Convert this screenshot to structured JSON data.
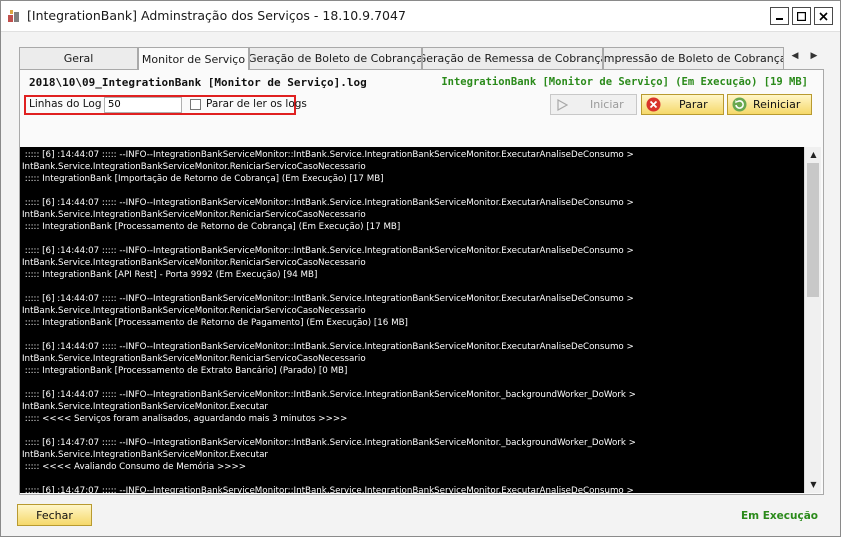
{
  "window": {
    "title": "[IntegrationBank] Adminstração dos Serviços - 18.10.9.7047",
    "controls": [
      "minimize-icon",
      "maximize-icon",
      "close-icon"
    ]
  },
  "tabs": [
    {
      "label": "Geral",
      "active": false
    },
    {
      "label": "Monitor de Serviço",
      "active": true
    },
    {
      "label": "Geração de Boleto de Cobrança",
      "active": false
    },
    {
      "label": "Geração de Remessa de Cobrança",
      "active": false
    },
    {
      "label": "Impressão de Boleto de Cobrança",
      "active": false
    }
  ],
  "monitor": {
    "log_file": "2018\\10\\09_IntegrationBank [Monitor de Serviço].log",
    "service_status": "IntegrationBank [Monitor de Serviço] (Em Execução) [19 MB]",
    "lines_label": "Linhas do Log",
    "lines_value": "50",
    "stop_reading_label": "Parar de ler os logs",
    "stop_reading_checked": false,
    "buttons": {
      "start": "Iniciar",
      "stop": "Parar",
      "restart": "Reiniciar"
    },
    "log_entries": [
      [
        " ::::: [6] :14:44:07 ::::: --INFO--IntegrationBankServiceMonitor::IntBank.Service.IntegrationBankServiceMonitor.ExecutarAnaliseDeConsumo >",
        "IntBank.Service.IntegrationBankServiceMonitor.ReniciarServicoCasoNecessario",
        " ::::: IntegrationBank [Importação de Retorno de Cobrança] (Em Execução) [17 MB]"
      ],
      [
        " ::::: [6] :14:44:07 ::::: --INFO--IntegrationBankServiceMonitor::IntBank.Service.IntegrationBankServiceMonitor.ExecutarAnaliseDeConsumo >",
        "IntBank.Service.IntegrationBankServiceMonitor.ReniciarServicoCasoNecessario",
        " ::::: IntegrationBank [Processamento de Retorno de Cobrança] (Em Execução) [17 MB]"
      ],
      [
        " ::::: [6] :14:44:07 ::::: --INFO--IntegrationBankServiceMonitor::IntBank.Service.IntegrationBankServiceMonitor.ExecutarAnaliseDeConsumo >",
        "IntBank.Service.IntegrationBankServiceMonitor.ReniciarServicoCasoNecessario",
        " ::::: IntegrationBank [API Rest] - Porta 9992 (Em Execução) [94 MB]"
      ],
      [
        " ::::: [6] :14:44:07 ::::: --INFO--IntegrationBankServiceMonitor::IntBank.Service.IntegrationBankServiceMonitor.ExecutarAnaliseDeConsumo >",
        "IntBank.Service.IntegrationBankServiceMonitor.ReniciarServicoCasoNecessario",
        " ::::: IntegrationBank [Processamento de Retorno de Pagamento] (Em Execução) [16 MB]"
      ],
      [
        " ::::: [6] :14:44:07 ::::: --INFO--IntegrationBankServiceMonitor::IntBank.Service.IntegrationBankServiceMonitor.ExecutarAnaliseDeConsumo >",
        "IntBank.Service.IntegrationBankServiceMonitor.ReniciarServicoCasoNecessario",
        " ::::: IntegrationBank [Processamento de Extrato Bancário] (Parado) [0 MB]"
      ],
      [
        " ::::: [6] :14:44:07 ::::: --INFO--IntegrationBankServiceMonitor::IntBank.Service.IntegrationBankServiceMonitor._backgroundWorker_DoWork >",
        "IntBank.Service.IntegrationBankServiceMonitor.Executar",
        " ::::: <<<< Serviços foram analisados, aguardando mais 3 minutos >>>>"
      ],
      [
        " ::::: [6] :14:47:07 ::::: --INFO--IntegrationBankServiceMonitor::IntBank.Service.IntegrationBankServiceMonitor._backgroundWorker_DoWork >",
        "IntBank.Service.IntegrationBankServiceMonitor.Executar",
        " ::::: <<<< Avaliando Consumo de Memória >>>>"
      ],
      [
        " ::::: [6] :14:47:07 ::::: --INFO--IntegrationBankServiceMonitor::IntBank.Service.IntegrationBankServiceMonitor.ExecutarAnaliseDeConsumo >"
      ]
    ]
  },
  "footer": {
    "close_button": "Fechar",
    "status": "Em Execução"
  },
  "colors": {
    "status_green": "#2a8a1a",
    "highlight_red": "#e02020",
    "button_yellow": "#f5d86a",
    "console_bg": "#000000"
  }
}
